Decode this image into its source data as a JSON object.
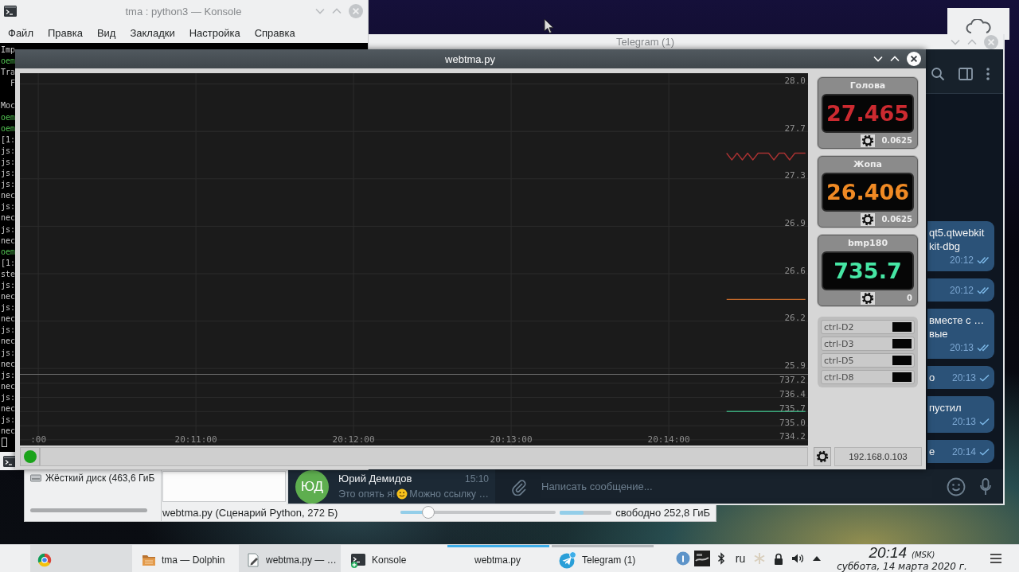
{
  "konsole_window": {
    "title": "tma : python3 — Konsole",
    "active": false,
    "menu": [
      "Файл",
      "Правка",
      "Вид",
      "Закладки",
      "Настройка",
      "Справка"
    ],
    "lines": [
      {
        "kind": "output",
        "text": "Imp"
      },
      {
        "kind": "prompt",
        "text": "oem"
      },
      {
        "kind": "output",
        "text": "Tra"
      },
      {
        "kind": "indented",
        "text": "F"
      },
      {
        "kind": "blank"
      },
      {
        "kind": "output",
        "text": "Moc"
      },
      {
        "kind": "prompt",
        "text": "oem"
      },
      {
        "kind": "prompt",
        "text": "oem"
      },
      {
        "kind": "output",
        "text": "[1:"
      },
      {
        "kind": "output",
        "text": "js:"
      },
      {
        "kind": "output",
        "text": "js:"
      },
      {
        "kind": "output",
        "text": "js:"
      },
      {
        "kind": "output",
        "text": "js:"
      },
      {
        "kind": "output",
        "text": "nec"
      },
      {
        "kind": "output",
        "text": "js:"
      },
      {
        "kind": "output",
        "text": "nec"
      },
      {
        "kind": "output",
        "text": "js:"
      },
      {
        "kind": "output",
        "text": "nec"
      },
      {
        "kind": "prompt",
        "text": "oem"
      },
      {
        "kind": "output",
        "text": "[1:"
      },
      {
        "kind": "output",
        "text": "ste"
      },
      {
        "kind": "output",
        "text": "js:"
      },
      {
        "kind": "output",
        "text": "nec"
      },
      {
        "kind": "output",
        "text": "js:"
      },
      {
        "kind": "output",
        "text": "nec"
      },
      {
        "kind": "output",
        "text": "js:"
      },
      {
        "kind": "output",
        "text": "nec"
      },
      {
        "kind": "output",
        "text": "js:"
      },
      {
        "kind": "output",
        "text": "nec"
      },
      {
        "kind": "output",
        "text": "js:"
      },
      {
        "kind": "output",
        "text": "nec"
      },
      {
        "kind": "output",
        "text": "js:"
      },
      {
        "kind": "output",
        "text": "nec"
      },
      {
        "kind": "output",
        "text": "js:"
      },
      {
        "kind": "output",
        "text": "nec"
      }
    ]
  },
  "dolphin_window": {
    "places": [
      "Жёсткий диск (463,6 ГиБ"
    ],
    "status_text": "webtma.py (Сценарий Python, 272 Б)",
    "zoom_slider": {
      "level": 0.18
    },
    "free_space": {
      "level": 0.45,
      "text": "свободно 252,8 ГиБ"
    }
  },
  "telegram_window": {
    "title": "Telegram (1)",
    "active": false,
    "chats": [
      {
        "initials": "ЮД",
        "name": "Юрий Демидов",
        "time": "15:10",
        "preview": [
          {
            "kind": "text",
            "text": "Это опять я!"
          },
          {
            "kind": "emoji"
          },
          {
            "kind": "text",
            "text": "Можно ссылку …"
          }
        ]
      }
    ],
    "messages": [
      {
        "lines": [
          "qt5.qtwebkit",
          "kit-dbg"
        ],
        "time": "20:12",
        "read": true
      },
      {
        "time": "20:12",
        "read": true
      },
      {
        "lines": [
          "вместе с …",
          "вые"
        ],
        "time": "20:13",
        "read": true
      },
      {
        "last_line": "о",
        "time": "20:13",
        "read": false
      },
      {
        "lines": [
          "пустил"
        ],
        "time": "20:13",
        "read": false
      },
      {
        "last_line": "е",
        "time": "20:14",
        "read": false
      }
    ],
    "composer": {
      "placeholder": "Написать сообщение..."
    }
  },
  "webtma_window": {
    "title": "webtma.py",
    "active": true,
    "plots": [
      {
        "chart_data": {
          "type": "line",
          "grid": true,
          "ylim": [
            25.86,
            28.08
          ],
          "yticks": [
            {
              "value": 28.0,
              "label": "28.0"
            },
            {
              "value": 27.65,
              "label": "27.7"
            },
            {
              "value": 27.3,
              "label": "27.3"
            },
            {
              "value": 26.95,
              "label": "26.9"
            },
            {
              "value": 26.6,
              "label": "26.6"
            },
            {
              "value": 26.25,
              "label": "26.2"
            },
            {
              "value": 25.9,
              "label": "25.9"
            }
          ],
          "series": [
            {
              "color": "#a83232",
              "values": [
                null,
                null,
                null,
                null,
                null,
                null,
                null,
                null,
                null,
                null,
                null,
                null,
                null,
                null,
                null,
                null,
                null,
                null,
                null,
                null,
                null,
                null,
                null,
                null,
                null,
                null,
                null,
                null,
                null,
                null,
                null,
                null,
                null,
                null,
                null,
                null,
                null,
                null,
                null,
                null,
                null,
                null,
                null,
                null,
                null,
                null,
                null,
                null,
                null,
                null,
                null,
                null,
                null,
                null,
                null,
                null,
                null,
                null,
                null,
                null,
                null,
                null,
                null,
                null,
                null,
                null,
                null,
                null,
                null,
                null,
                null,
                null,
                null,
                null,
                null,
                null,
                null,
                null,
                null,
                null,
                null,
                null,
                null,
                null,
                null,
                null,
                null,
                null,
                null,
                null,
                null,
                null,
                null,
                null,
                null,
                null,
                null,
                null,
                null,
                null,
                null,
                null,
                null,
                null,
                null,
                null,
                null,
                null,
                null,
                null,
                null,
                null,
                null,
                null,
                null,
                null,
                null,
                null,
                null,
                null,
                null,
                null,
                null,
                null,
                null,
                null,
                null,
                null,
                null,
                null,
                null,
                null,
                null,
                null,
                27.49,
                27.44,
                27.49,
                27.44,
                27.49,
                27.44,
                27.49,
                27.49,
                27.49,
                27.44,
                27.49,
                27.49,
                27.44,
                27.49,
                27.49,
                27.49
              ]
            },
            {
              "color": "#c4692a",
              "values": [
                null,
                null,
                null,
                null,
                null,
                null,
                null,
                null,
                null,
                null,
                null,
                null,
                null,
                null,
                null,
                null,
                null,
                null,
                null,
                null,
                null,
                null,
                null,
                null,
                null,
                null,
                null,
                null,
                null,
                null,
                null,
                null,
                null,
                null,
                null,
                null,
                null,
                null,
                null,
                null,
                null,
                null,
                null,
                null,
                null,
                null,
                null,
                null,
                null,
                null,
                null,
                null,
                null,
                null,
                null,
                null,
                null,
                null,
                null,
                null,
                null,
                null,
                null,
                null,
                null,
                null,
                null,
                null,
                null,
                null,
                null,
                null,
                null,
                null,
                null,
                null,
                null,
                null,
                null,
                null,
                null,
                null,
                null,
                null,
                null,
                null,
                null,
                null,
                null,
                null,
                null,
                null,
                null,
                null,
                null,
                null,
                null,
                null,
                null,
                null,
                null,
                null,
                null,
                null,
                null,
                null,
                null,
                null,
                null,
                null,
                null,
                null,
                null,
                null,
                null,
                null,
                null,
                null,
                null,
                null,
                null,
                null,
                null,
                null,
                null,
                null,
                null,
                null,
                null,
                null,
                null,
                null,
                null,
                null,
                26.41,
                26.41,
                26.41,
                26.41,
                26.41,
                26.41,
                26.41,
                26.41,
                26.41,
                26.41,
                26.41,
                26.41,
                26.41,
                26.41,
                26.41,
                26.41
              ]
            }
          ]
        }
      },
      {
        "chart_data": {
          "type": "line",
          "grid": true,
          "categories": [
            null,
            null,
            null,
            ":00",
            null,
            null,
            null,
            null,
            null,
            null,
            null,
            null,
            null,
            null,
            null,
            null,
            null,
            null,
            null,
            null,
            null,
            null,
            null,
            null,
            null,
            null,
            null,
            null,
            null,
            null,
            null,
            null,
            null,
            "20:11:00",
            null,
            null,
            null,
            null,
            null,
            null,
            null,
            null,
            null,
            null,
            null,
            null,
            null,
            null,
            null,
            null,
            null,
            null,
            null,
            null,
            null,
            null,
            null,
            null,
            null,
            null,
            null,
            null,
            null,
            "20:12:00",
            null,
            null,
            null,
            null,
            null,
            null,
            null,
            null,
            null,
            null,
            null,
            null,
            null,
            null,
            null,
            null,
            null,
            null,
            null,
            null,
            null,
            null,
            null,
            null,
            null,
            null,
            null,
            null,
            null,
            "20:13:00",
            null,
            null,
            null,
            null,
            null,
            null,
            null,
            null,
            null,
            null,
            null,
            null,
            null,
            null,
            null,
            null,
            null,
            null,
            null,
            null,
            null,
            null,
            null,
            null,
            null,
            null,
            null,
            null,
            null,
            "20:14:00",
            null,
            null,
            null,
            null,
            null,
            null,
            null,
            null,
            null,
            null,
            null,
            null,
            null,
            null,
            null,
            null,
            null,
            null,
            null,
            null,
            null,
            null,
            null,
            null,
            null,
            null
          ],
          "ylim": [
            733.9,
            737.65
          ],
          "yticks": [
            {
              "value": 737.2,
              "label": "737.2"
            },
            {
              "value": 736.45,
              "label": "736.4"
            },
            {
              "value": 735.7,
              "label": "735.7"
            },
            {
              "value": 734.95,
              "label": "735.0"
            },
            {
              "value": 734.2,
              "label": "734.2"
            }
          ],
          "series": [
            {
              "color": "#3aa77b",
              "values": [
                null,
                null,
                null,
                null,
                null,
                null,
                null,
                null,
                null,
                null,
                null,
                null,
                null,
                null,
                null,
                null,
                null,
                null,
                null,
                null,
                null,
                null,
                null,
                null,
                null,
                null,
                null,
                null,
                null,
                null,
                null,
                null,
                null,
                null,
                null,
                null,
                null,
                null,
                null,
                null,
                null,
                null,
                null,
                null,
                null,
                null,
                null,
                null,
                null,
                null,
                null,
                null,
                null,
                null,
                null,
                null,
                null,
                null,
                null,
                null,
                null,
                null,
                null,
                null,
                null,
                null,
                null,
                null,
                null,
                null,
                null,
                null,
                null,
                null,
                null,
                null,
                null,
                null,
                null,
                null,
                null,
                null,
                null,
                null,
                null,
                null,
                null,
                null,
                null,
                null,
                null,
                null,
                null,
                null,
                null,
                null,
                null,
                null,
                null,
                null,
                null,
                null,
                null,
                null,
                null,
                null,
                null,
                null,
                null,
                null,
                null,
                null,
                null,
                null,
                null,
                null,
                null,
                null,
                null,
                null,
                null,
                null,
                null,
                null,
                null,
                null,
                null,
                null,
                null,
                null,
                null,
                null,
                null,
                null,
                735.7,
                735.7,
                735.7,
                735.7,
                735.7,
                735.7,
                735.7,
                735.7,
                735.7,
                735.7,
                735.7,
                735.7,
                735.7,
                735.7,
                735.7,
                735.7
              ]
            }
          ]
        }
      }
    ],
    "gauges": [
      {
        "title": "Голова",
        "value": "27.465",
        "color": "#cc2a30",
        "step": "0.0625"
      },
      {
        "title": "Жопа",
        "value": "26.406",
        "color": "#f08a24",
        "step": "0.0625"
      },
      {
        "title": "bmp180",
        "value": "735.7",
        "color": "#46e6a4",
        "step": "0"
      }
    ],
    "outputs": [
      {
        "label": "ctrl-D2",
        "on": false
      },
      {
        "label": "ctrl-D3",
        "on": false
      },
      {
        "label": "ctrl-D5",
        "on": false
      },
      {
        "label": "ctrl-D8",
        "on": false
      }
    ],
    "status": {
      "connected": true,
      "address": "192.168.0.103"
    }
  },
  "taskbar": {
    "tasks": [
      {
        "kind": "browser",
        "selected": false,
        "highlighted": true,
        "attention": false
      },
      {
        "kind": "files",
        "label": "tma — Dolphin",
        "selected": false,
        "highlighted": false,
        "attention": false
      },
      {
        "kind": "editor",
        "label": "webtma.py — …",
        "selected": false,
        "highlighted": true,
        "attention": false
      },
      {
        "kind": "terminal",
        "label": "Konsole",
        "selected": false,
        "highlighted": false,
        "attention": false
      },
      {
        "kind": "plain",
        "label": "webtma.py",
        "selected": true,
        "highlighted": false,
        "attention": false
      },
      {
        "kind": "messenger",
        "label": "Telegram (1)",
        "selected": false,
        "highlighted": false,
        "attention": true
      }
    ],
    "tray": {
      "language": "ru"
    },
    "clock": {
      "time": "20:14",
      "zone": "(MSK)",
      "date": "суббота, 14 марта 2020 г."
    }
  }
}
